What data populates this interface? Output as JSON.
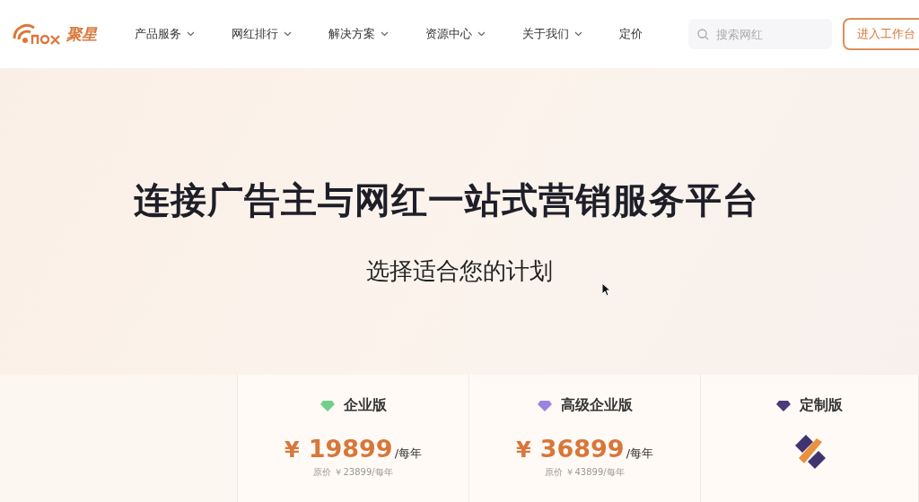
{
  "logo": {
    "text": "聚星"
  },
  "nav": [
    {
      "label": "产品服务",
      "dropdown": true
    },
    {
      "label": "网红排行",
      "dropdown": true
    },
    {
      "label": "解决方案",
      "dropdown": true
    },
    {
      "label": "资源中心",
      "dropdown": true
    },
    {
      "label": "关于我们",
      "dropdown": true
    },
    {
      "label": "定价",
      "dropdown": false
    }
  ],
  "search": {
    "placeholder": "搜索网红"
  },
  "cta": "进入工作台",
  "hero": {
    "title": "连接广告主与网红一站式营销服务平台",
    "subtitle": "选择适合您的计划"
  },
  "plans": [
    {
      "kind": "priced",
      "name": "企业版",
      "color": "#6fd08c",
      "currency": "¥",
      "price": "19899",
      "period": "/每年",
      "original": "原价 ￥23899/每年"
    },
    {
      "kind": "priced",
      "name": "高级企业版",
      "color": "#9b84e0",
      "currency": "¥",
      "price": "36899",
      "period": "/每年",
      "original": "原价 ￥43899/每年"
    },
    {
      "kind": "custom",
      "name": "定制版",
      "color": "#4a3a7a"
    }
  ]
}
